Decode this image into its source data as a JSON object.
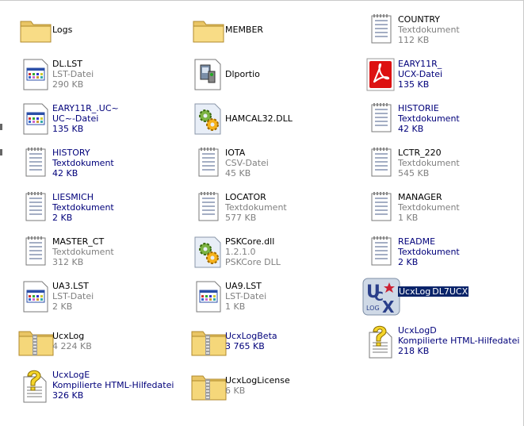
{
  "items": [
    {
      "name": "Logs",
      "type": "",
      "size": "",
      "icon": "folder-icon",
      "color": "black"
    },
    {
      "name": "MEMBER",
      "type": "",
      "size": "",
      "icon": "folder-icon",
      "color": "black"
    },
    {
      "name": "COUNTRY",
      "type": "Textdokument",
      "size": "112 KB",
      "icon": "text-document-icon",
      "color": "gray"
    },
    {
      "name": "DL.LST",
      "type": "LST-Datei",
      "size": "290 KB",
      "icon": "window-file-icon",
      "color": "gray"
    },
    {
      "name": "Dlportio",
      "type": "",
      "size": "",
      "icon": "driver-file-icon",
      "color": "black"
    },
    {
      "name": "EARY11R_",
      "type": "UCX-Datei",
      "size": "135 KB",
      "icon": "pdf-icon",
      "color": "blue"
    },
    {
      "name": "EARY11R_.UC~",
      "type": "UC~-Datei",
      "size": "135 KB",
      "icon": "window-file-icon",
      "color": "blue"
    },
    {
      "name": "HAMCAL32.DLL",
      "type": "",
      "size": "",
      "icon": "dll-gears-icon",
      "color": "black"
    },
    {
      "name": "HISTORIE",
      "type": "Textdokument",
      "size": "42 KB",
      "icon": "text-document-icon",
      "color": "blue"
    },
    {
      "name": "HISTORY",
      "type": "Textdokument",
      "size": "42 KB",
      "icon": "text-document-icon",
      "color": "blue"
    },
    {
      "name": "IOTA",
      "type": "CSV-Datei",
      "size": "45 KB",
      "icon": "text-document-icon",
      "color": "gray"
    },
    {
      "name": "LCTR_220",
      "type": "Textdokument",
      "size": "545 KB",
      "icon": "text-document-icon",
      "color": "gray"
    },
    {
      "name": "LIESMICH",
      "type": "Textdokument",
      "size": "2 KB",
      "icon": "text-document-icon",
      "color": "blue"
    },
    {
      "name": "LOCATOR",
      "type": "Textdokument",
      "size": "577 KB",
      "icon": "text-document-icon",
      "color": "gray"
    },
    {
      "name": "MANAGER",
      "type": "Textdokument",
      "size": "1 KB",
      "icon": "text-document-icon",
      "color": "gray"
    },
    {
      "name": "MASTER_CT",
      "type": "Textdokument",
      "size": "312 KB",
      "icon": "text-document-icon",
      "color": "gray"
    },
    {
      "name": "PSKCore.dll",
      "type": "1.2.1.0",
      "size": "PSKCore DLL",
      "icon": "dll-gears-icon",
      "color": "gray"
    },
    {
      "name": "README",
      "type": "Textdokument",
      "size": "2 KB",
      "icon": "text-document-icon",
      "color": "blue"
    },
    {
      "name": "UA3.LST",
      "type": "LST-Datei",
      "size": "2 KB",
      "icon": "window-file-icon",
      "color": "gray"
    },
    {
      "name": "UA9.LST",
      "type": "LST-Datei",
      "size": "1 KB",
      "icon": "window-file-icon",
      "color": "gray"
    },
    {
      "name": "UcxLog",
      "type": "DL7UCX",
      "size": "",
      "icon": "ucx-logo-icon",
      "color": "blue",
      "selected": true
    },
    {
      "name": "UcxLog",
      "type": "",
      "size": "4 224 KB",
      "icon": "zip-folder-icon",
      "color": "gray"
    },
    {
      "name": "UcxLogBeta",
      "type": "",
      "size": "3 765 KB",
      "icon": "zip-folder-icon",
      "color": "blue"
    },
    {
      "name": "UcxLogD",
      "type": "Kompilierte HTML-Hilfedatei",
      "size": "218 KB",
      "icon": "help-file-icon",
      "color": "blue"
    },
    {
      "name": "UcxLogE",
      "type": "Kompilierte HTML-Hilfedatei",
      "size": "326 KB",
      "icon": "help-file-icon",
      "color": "blue"
    },
    {
      "name": "UcxLogLicense",
      "type": "",
      "size": "6 KB",
      "icon": "zip-folder-icon",
      "color": "gray"
    }
  ]
}
